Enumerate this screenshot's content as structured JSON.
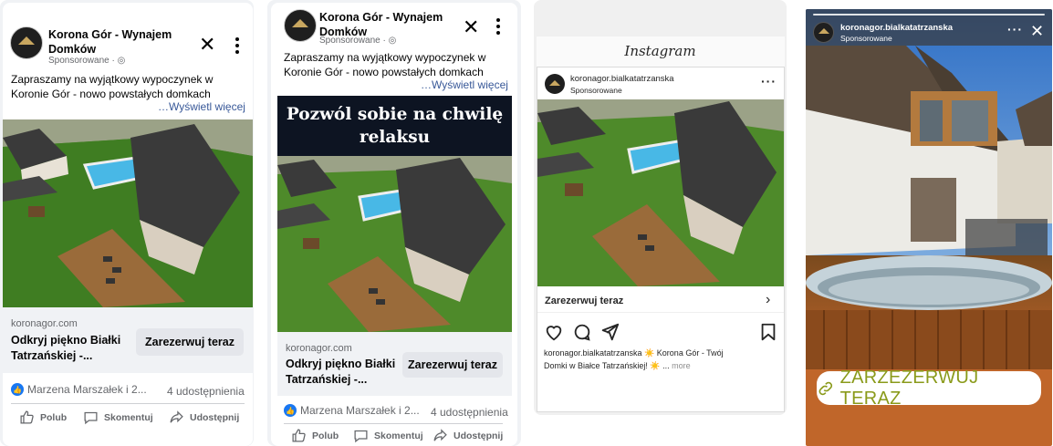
{
  "brand": {
    "page_name": "Korona Gór - Wynajem Domków",
    "sponsored": "Sponsorowane",
    "ig_username": "koronagor.bialkatatrzanska",
    "ig_sponsored": "Sponsorowane"
  },
  "fb_feed": {
    "text": "Zapraszamy na wyjątkowy wypoczynek w Koronie Gór - nowo powstałych domkach",
    "see_more": "…Wyświetl więcej",
    "domain": "koronagor.com",
    "headline": "Odkryj piękno Białki Tatrzańskiej -...",
    "cta": "Zarezerwuj teraz",
    "reactions": "Marzena Marszałek i 2...",
    "shares": "4 udostępnienia",
    "actions": {
      "like": "Polub",
      "comment": "Skomentuj",
      "share": "Udostępnij"
    }
  },
  "fb_mobile": {
    "text": "Zapraszamy na wyjątkowy wypoczynek w Koronie Gór - nowo powstałych domkach",
    "see_more": "…Wyświetl więcej",
    "banner": "Pozwól sobie na chwilę relaksu",
    "domain": "koronagor.com",
    "headline": "Odkryj piękno Białki Tatrzańskiej -...",
    "cta": "Zarezerwuj teraz",
    "reactions": "Marzena Marszałek i 2...",
    "shares": "4 udostępnienia",
    "actions": {
      "like": "Polub",
      "comment": "Skomentuj",
      "share": "Udostępnij"
    }
  },
  "ig_feed": {
    "logo": "Instagram",
    "cta": "Zarezerwuj teraz",
    "caption_user": "koronagor.bialkatatrzanska",
    "caption_text": "☀️ Korona Gór - Twój Domki w Białce Tatrzańskiej! ☀️ ...",
    "caption_more": "more"
  },
  "ig_story": {
    "cta": "ZARZEZERWUJ TERAZ"
  },
  "colors": {
    "fb_blue": "#1877f2",
    "link_blue": "#385898",
    "banner_bg": "#0d1422",
    "story_cta_text": "#8a9a1a"
  }
}
